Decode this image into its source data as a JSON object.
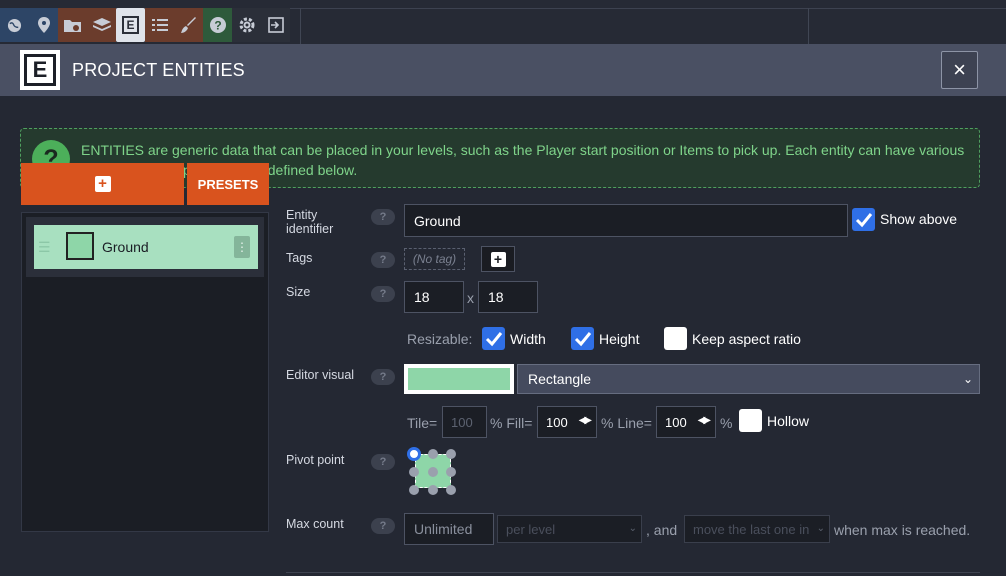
{
  "toolbar": {
    "icons": [
      "world-icon",
      "map-pin-icon",
      "folder-gear-icon",
      "layers-icon",
      "entity-icon",
      "list-icon",
      "brush-icon",
      "help-icon",
      "settings-icon",
      "exit-icon"
    ]
  },
  "dialog": {
    "logo_letter": "E",
    "title": "PROJECT ENTITIES",
    "close_glyph": "×"
  },
  "help": {
    "icon_glyph": "?",
    "text": "ENTITIES are generic data that can be placed in your levels, such as the Player start position or Items to pick up. Each entity can have various custom editable properties as defined below."
  },
  "left_panel": {
    "add_glyph": "+",
    "presets_label": "PRESETS",
    "entities": [
      {
        "name": "Ground",
        "color": "#8ed6a8"
      }
    ]
  },
  "form": {
    "identifier_label": "Entity identifier",
    "identifier_value": "Ground",
    "show_above_label": "Show above",
    "show_above_checked": true,
    "tags_label": "Tags",
    "no_tag_text": "(No tag)",
    "size_label": "Size",
    "width_value": "18",
    "height_value": "18",
    "size_sep": "x",
    "resizable_label": "Resizable:",
    "width_check_label": "Width",
    "width_checked": true,
    "height_check_label": "Height",
    "height_checked": true,
    "aspect_label": "Keep aspect ratio",
    "aspect_checked": false,
    "editor_visual_label": "Editor visual",
    "color": "#8ed6a8",
    "shape_value": "Rectangle",
    "tile_label": "Tile=",
    "tile_value": "100",
    "fill_label": "% Fill=",
    "fill_value": "100",
    "line_label": "% Line=",
    "line_value": "100",
    "percent": "%",
    "hollow_label": "Hollow",
    "hollow_checked": false,
    "pivot_label": "Pivot point",
    "max_count_label": "Max count",
    "max_count_placeholder": "Unlimited",
    "per_value": "per level",
    "and_text": ", and",
    "behavior_value": "move the last one in",
    "when_text": "when max is reached.",
    "help_glyph": "?"
  }
}
